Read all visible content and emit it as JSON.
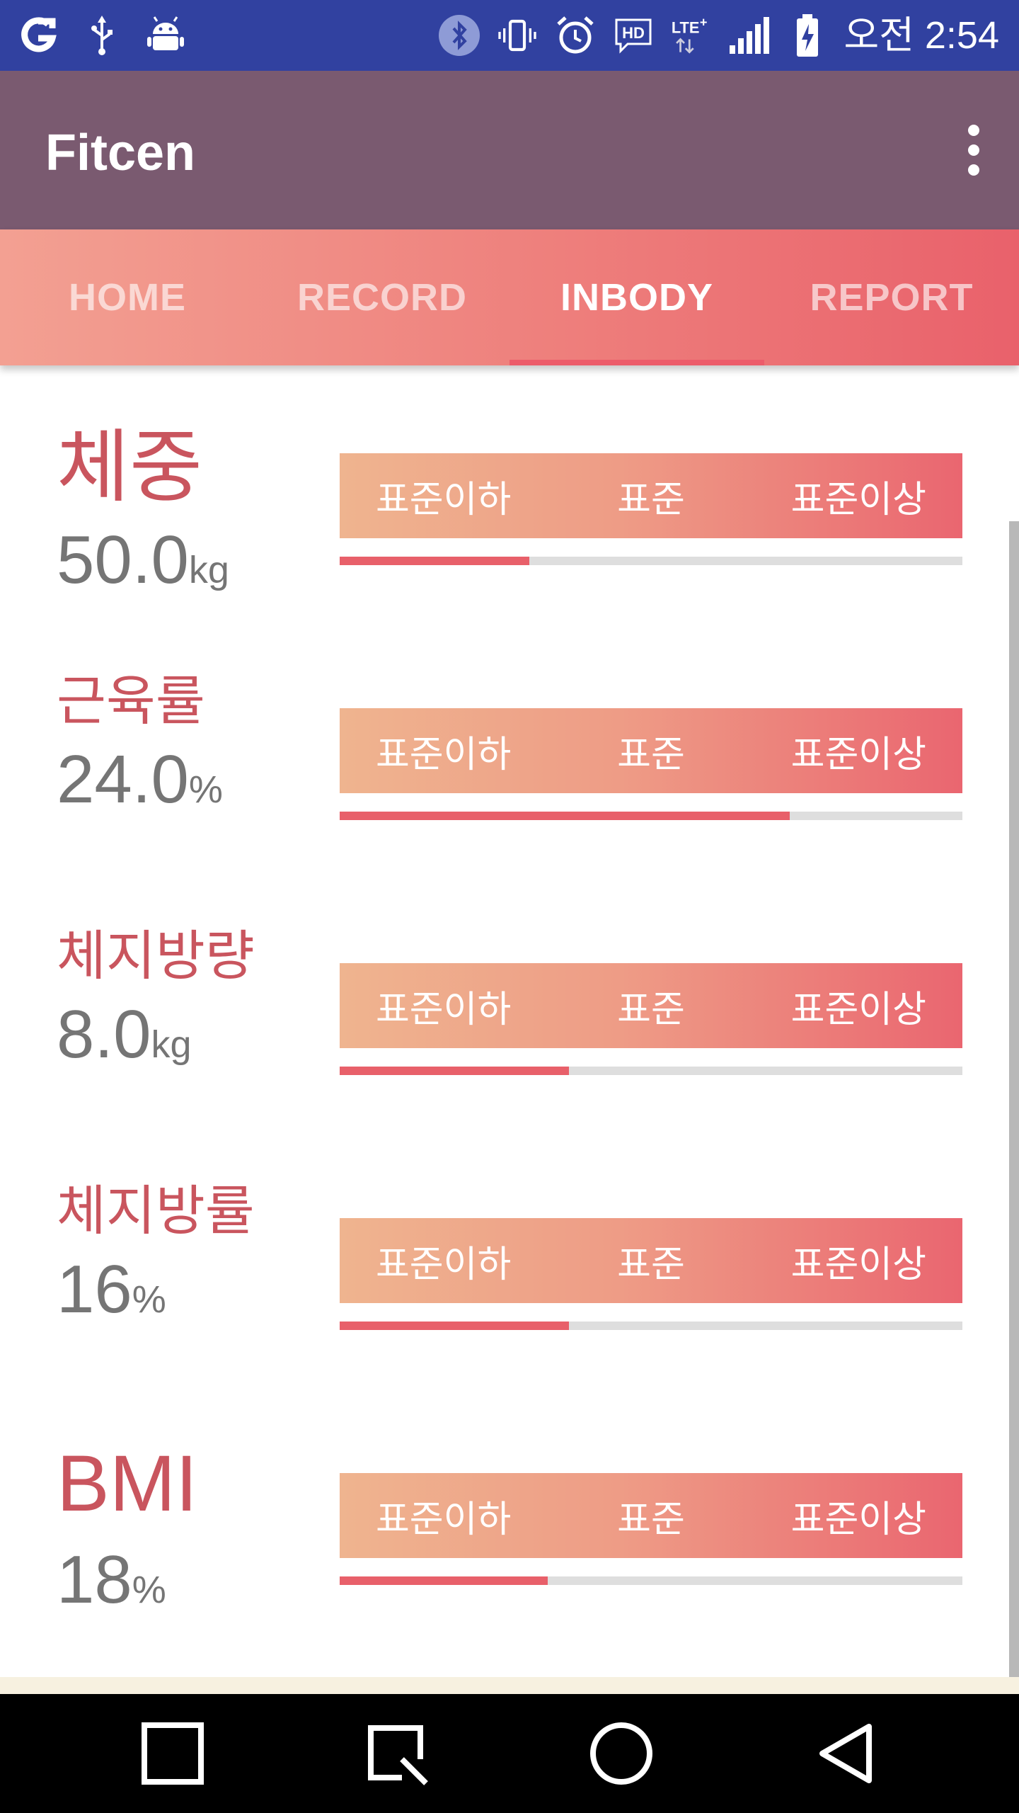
{
  "status_bar": {
    "time": "오전 2:54",
    "icons": [
      "g-app-icon",
      "usb-icon",
      "android-debug-icon",
      "bluetooth-icon",
      "vibrate-icon",
      "alarm-icon",
      "hd-voice-icon",
      "lte-plus-icon",
      "signal-icon",
      "battery-charging-icon"
    ]
  },
  "app_bar": {
    "title": "Fitcen",
    "menu_icon": "overflow-menu-icon"
  },
  "tabs": [
    {
      "label": "HOME",
      "active": false
    },
    {
      "label": "RECORD",
      "active": false
    },
    {
      "label": "INBODY",
      "active": true
    },
    {
      "label": "REPORT",
      "active": false
    }
  ],
  "colors": {
    "status_bar": "#3141a0",
    "app_bar": "#7a5a70",
    "accent": "#e8606a",
    "title_text": "#c9555e",
    "value_text": "#757575"
  },
  "metrics": [
    {
      "title": "체중",
      "value": "50.0",
      "unit": "kg",
      "scale": [
        "표준이하",
        "표준",
        "표준이상"
      ],
      "progress": 0.305
    },
    {
      "title": "근육률",
      "value": "24.0",
      "unit": "%",
      "scale": [
        "표준이하",
        "표준",
        "표준이상"
      ],
      "progress": 0.723
    },
    {
      "title": "체지방량",
      "value": "8.0",
      "unit": "kg",
      "scale": [
        "표준이하",
        "표준",
        "표준이상"
      ],
      "progress": 0.368
    },
    {
      "title": "체지방률",
      "value": "16",
      "unit": "%",
      "scale": [
        "표준이하",
        "표준",
        "표준이상"
      ],
      "progress": 0.368
    },
    {
      "title": "BMI",
      "value": "18",
      "unit": "%",
      "scale": [
        "표준이하",
        "표준",
        "표준이상"
      ],
      "progress": 0.334
    }
  ],
  "nav_bar": {
    "buttons": [
      "recents-icon",
      "capture-icon",
      "home-icon",
      "back-icon"
    ]
  }
}
